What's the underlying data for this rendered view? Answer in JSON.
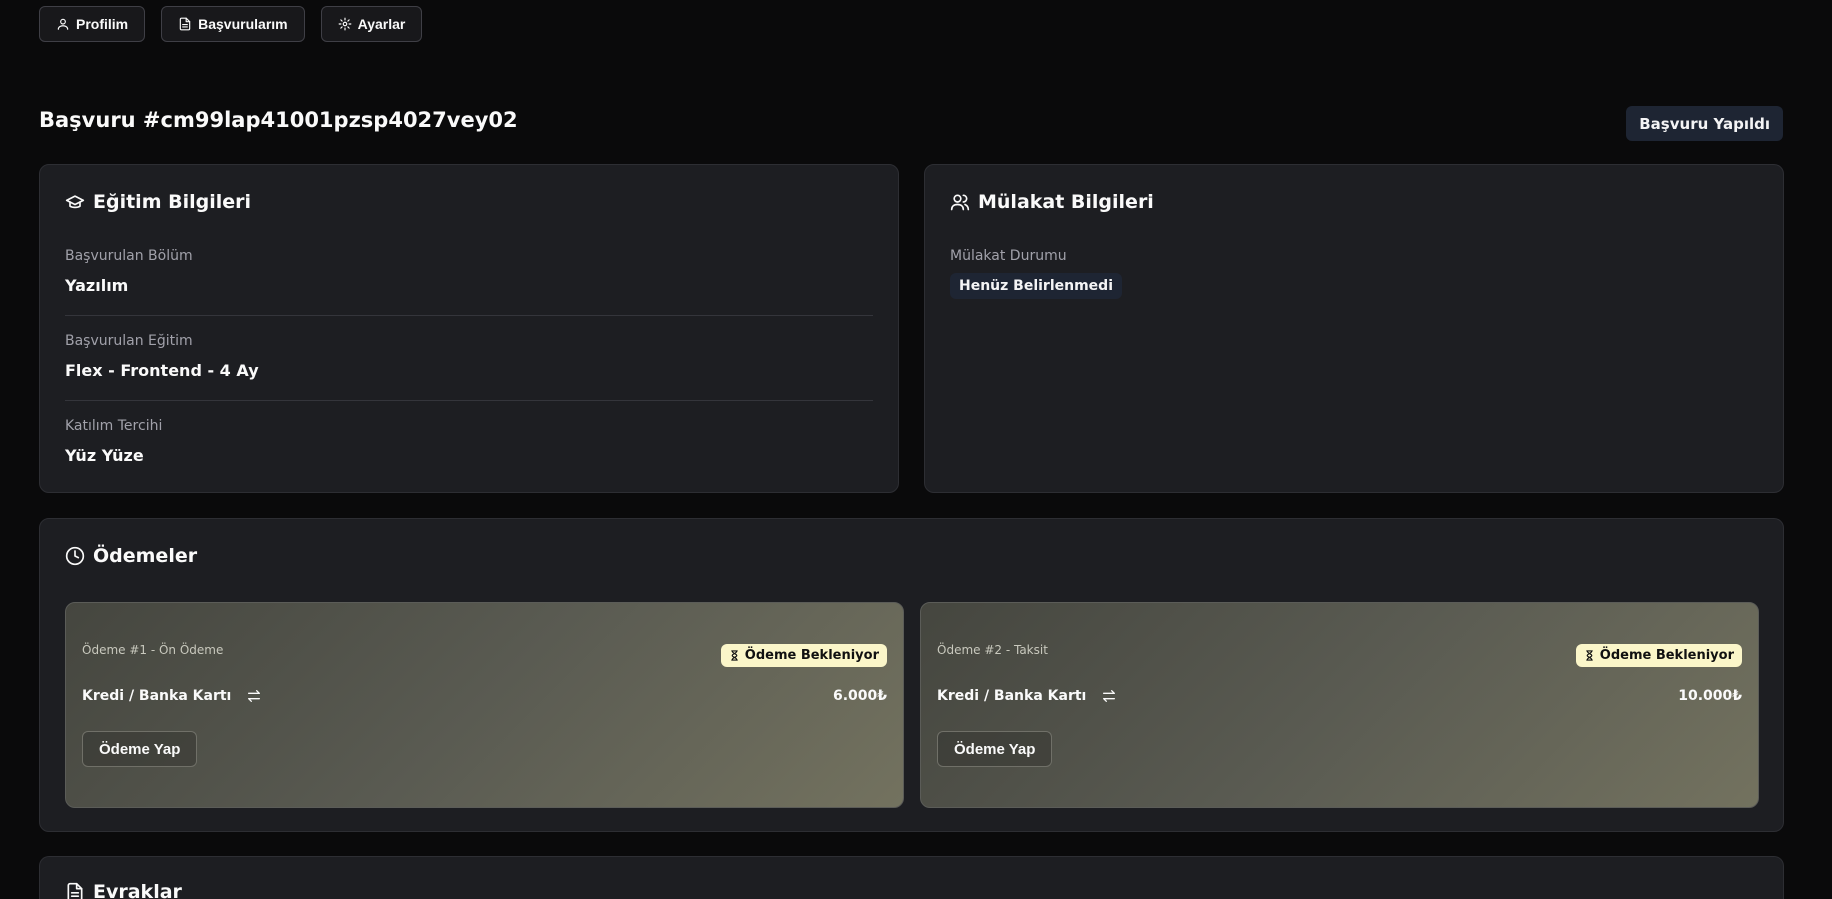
{
  "nav": {
    "profile": "Profilim",
    "applications": "Başvurularım",
    "settings": "Ayarlar"
  },
  "page": {
    "title": "Başvuru #cm99lap41001pzsp4027vey02",
    "status": "Başvuru Yapıldı"
  },
  "education": {
    "heading": "Eğitim Bilgileri",
    "fields": [
      {
        "label": "Başvurulan Bölüm",
        "value": "Yazılım"
      },
      {
        "label": "Başvurulan Eğitim",
        "value": "Flex - Frontend - 4 Ay"
      },
      {
        "label": "Katılım Tercihi",
        "value": "Yüz Yüze"
      }
    ]
  },
  "interview": {
    "heading": "Mülakat Bilgileri",
    "status_label": "Mülakat Durumu",
    "status_value": "Henüz Belirlenmedi"
  },
  "payments": {
    "heading": "Ödemeler",
    "items": [
      {
        "title": "Ödeme #1 - Ön Ödeme",
        "badge": "Ödeme Bekleniyor",
        "method": "Kredi / Banka Kartı",
        "amount": "6.000₺",
        "button": "Ödeme Yap"
      },
      {
        "title": "Ödeme #2 - Taksit",
        "badge": "Ödeme Bekleniyor",
        "method": "Kredi / Banka Kartı",
        "amount": "10.000₺",
        "button": "Ödeme Yap"
      }
    ]
  },
  "documents": {
    "heading": "Evraklar"
  },
  "colors": {
    "background": "#0a0a0b",
    "card": "#1d1e22",
    "pending_badge": "#fbf6c9",
    "status_pill": "#1e2533"
  }
}
